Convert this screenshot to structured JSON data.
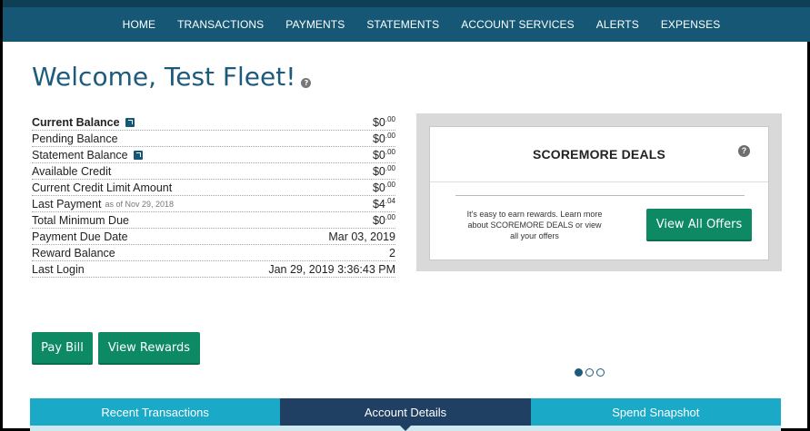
{
  "nav": {
    "items": [
      "HOME",
      "TRANSACTIONS",
      "PAYMENTS",
      "STATEMENTS",
      "ACCOUNT SERVICES",
      "ALERTS",
      "EXPENSES"
    ]
  },
  "welcome": {
    "title": "Welcome, Test Fleet!",
    "help": "?"
  },
  "balances": [
    {
      "label": "Current Balance",
      "sub": "",
      "value": "$0",
      "cents": ".00",
      "icon": "external-link-icon"
    },
    {
      "label": "Pending Balance",
      "sub": "",
      "value": "$0",
      "cents": ".00"
    },
    {
      "label": "Statement Balance",
      "sub": "",
      "value": "$0",
      "cents": ".00",
      "icon": "external-link-icon"
    },
    {
      "label": "Available Credit",
      "sub": "",
      "value": "$0",
      "cents": ".00"
    },
    {
      "label": "Current Credit Limit Amount",
      "sub": "",
      "value": "$0",
      "cents": ".00"
    },
    {
      "label": "Last Payment",
      "sub": "as of Nov 29, 2018",
      "value": "$4",
      "cents": ".04"
    },
    {
      "label": "Total Minimum Due",
      "sub": "",
      "value": "$0",
      "cents": ".00"
    },
    {
      "label": "Payment Due Date",
      "sub": "",
      "value": "Mar 03, 2019",
      "cents": ""
    },
    {
      "label": "Reward Balance",
      "sub": "",
      "value": "2",
      "cents": ""
    },
    {
      "label": "Last Login",
      "sub": "",
      "value": "Jan 29, 2019 3:36:43 PM",
      "cents": ""
    }
  ],
  "actions": {
    "pay_bill": "Pay Bill",
    "view_rewards": "View Rewards"
  },
  "deals": {
    "title": "SCOREMORE DEALS",
    "help": "?",
    "text": "It's easy to earn rewards. Learn more about SCOREMORE DEALS or view all your offers",
    "button": "View All Offers"
  },
  "carousel": {
    "count": 3,
    "active": 0
  },
  "tabs": [
    {
      "label": "Recent Transactions",
      "active": false
    },
    {
      "label": "Account Details",
      "active": true
    },
    {
      "label": "Spend Snapshot",
      "active": false
    }
  ],
  "colors": {
    "nav_bg": "#155774",
    "title": "#1c5b7b",
    "button_green": "#0d8a63",
    "tab_teal": "#1ba9c8",
    "tab_active": "#1f3f63"
  }
}
